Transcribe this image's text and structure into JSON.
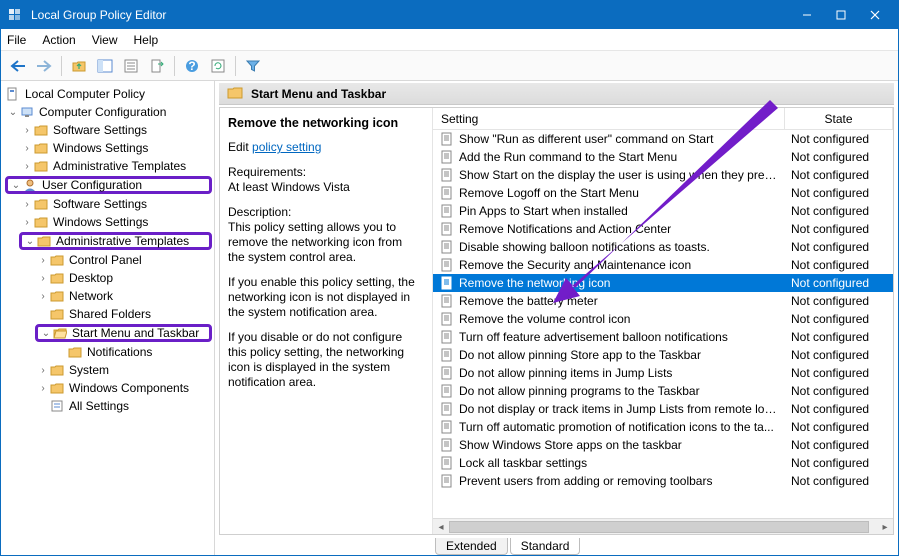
{
  "title": "Local Group Policy Editor",
  "menus": {
    "file": "File",
    "action": "Action",
    "view": "View",
    "help": "Help"
  },
  "tree": {
    "root": "Local Computer Policy",
    "cc": "Computer Configuration",
    "cc_software": "Software Settings",
    "cc_windows": "Windows Settings",
    "cc_admin": "Administrative Templates",
    "uc": "User Configuration",
    "uc_software": "Software Settings",
    "uc_windows": "Windows Settings",
    "uc_admin": "Administrative Templates",
    "cp": "Control Panel",
    "desktop": "Desktop",
    "network": "Network",
    "shared": "Shared Folders",
    "startmenu": "Start Menu and Taskbar",
    "notifications": "Notifications",
    "system": "System",
    "wincomp": "Windows Components",
    "allsettings": "All Settings"
  },
  "header": {
    "category": "Start Menu and Taskbar"
  },
  "details": {
    "title": "Remove the networking icon",
    "edit_prefix": "Edit",
    "edit_link": "policy setting",
    "req_label": "Requirements:",
    "req_value": "At least Windows Vista",
    "desc_label": "Description:",
    "desc_p1": "This policy setting allows you to remove the networking icon from the system control area.",
    "desc_p2": "If you enable this policy setting, the networking icon is not displayed in the system notification area.",
    "desc_p3": "If you disable or do not configure this policy setting, the networking icon is displayed in the system notification area."
  },
  "columns": {
    "setting": "Setting",
    "state": "State"
  },
  "settings": [
    {
      "name": "Show \"Run as different user\" command on Start",
      "state": "Not configured"
    },
    {
      "name": "Add the Run command to the Start Menu",
      "state": "Not configured"
    },
    {
      "name": "Show Start on the display the user is using when they press t...",
      "state": "Not configured"
    },
    {
      "name": "Remove Logoff on the Start Menu",
      "state": "Not configured"
    },
    {
      "name": "Pin Apps to Start when installed",
      "state": "Not configured"
    },
    {
      "name": "Remove Notifications and Action Center",
      "state": "Not configured"
    },
    {
      "name": "Disable showing balloon notifications as toasts.",
      "state": "Not configured"
    },
    {
      "name": "Remove the Security and Maintenance icon",
      "state": "Not configured"
    },
    {
      "name": "Remove the networking icon",
      "state": "Not configured",
      "selected": true
    },
    {
      "name": "Remove the battery meter",
      "state": "Not configured"
    },
    {
      "name": "Remove the volume control icon",
      "state": "Not configured"
    },
    {
      "name": "Turn off feature advertisement balloon notifications",
      "state": "Not configured"
    },
    {
      "name": "Do not allow pinning Store app to the Taskbar",
      "state": "Not configured"
    },
    {
      "name": "Do not allow pinning items in Jump Lists",
      "state": "Not configured"
    },
    {
      "name": "Do not allow pinning programs to the Taskbar",
      "state": "Not configured"
    },
    {
      "name": "Do not display or track items in Jump Lists from remote loca...",
      "state": "Not configured"
    },
    {
      "name": "Turn off automatic promotion of notification icons to the ta...",
      "state": "Not configured"
    },
    {
      "name": "Show Windows Store apps on the taskbar",
      "state": "Not configured"
    },
    {
      "name": "Lock all taskbar settings",
      "state": "Not configured"
    },
    {
      "name": "Prevent users from adding or removing toolbars",
      "state": "Not configured"
    }
  ],
  "tabs": {
    "extended": "Extended",
    "standard": "Standard"
  }
}
